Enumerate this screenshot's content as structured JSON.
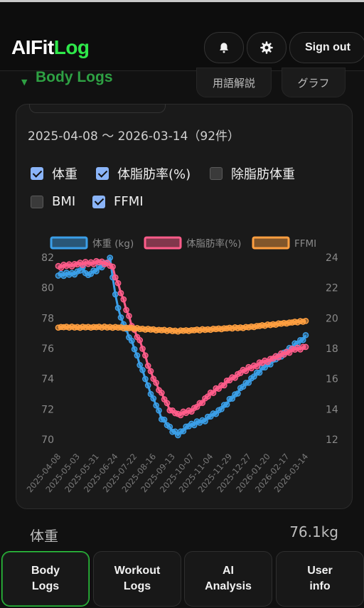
{
  "app": {
    "logo_part1": "AIFit",
    "logo_part2": "Log"
  },
  "header": {
    "bell_icon": "bell-icon",
    "settings_icon": "gear-icon",
    "sign_out_label": "Sign out"
  },
  "section": {
    "title": "Body Logs",
    "glossary_label": "用語解説",
    "graph_label": "グラフ"
  },
  "card": {
    "range_text": "2025-04-08 〜 2026-03-14（92件）",
    "checkboxes": [
      {
        "label": "体重",
        "checked": true
      },
      {
        "label": "体脂肪率(%)",
        "checked": true
      },
      {
        "label": "除脂肪体重",
        "checked": false
      },
      {
        "label": "BMI",
        "checked": false
      },
      {
        "label": "FFMI",
        "checked": true
      }
    ]
  },
  "chart_data": {
    "type": "line",
    "legend": [
      "体重 (kg)",
      "体脂肪率(%)",
      "FFMI"
    ],
    "legend_position": "top",
    "x_ticks": [
      "2025-04-08",
      "2025-05-03",
      "2025-05-31",
      "2025-06-24",
      "2025-07-22",
      "2025-08-16",
      "2025-09-13",
      "2025-10-07",
      "2025-11-04",
      "2025-11-29",
      "2025-12-27",
      "2026-01-20",
      "2026-02-17",
      "2026-03-14"
    ],
    "y_left": {
      "ticks": [
        70,
        72,
        74,
        76,
        78,
        80,
        82
      ],
      "range": [
        70,
        82
      ]
    },
    "y_right": {
      "ticks": [
        12,
        14,
        16,
        18,
        20,
        22,
        24
      ],
      "range": [
        12,
        24
      ]
    },
    "count": 92,
    "series": [
      {
        "name": "体重 (kg)",
        "axis": "left",
        "color": "#3b9fe8",
        "anchors": [
          [
            0,
            80.8
          ],
          [
            7,
            81.0
          ],
          [
            9,
            81.3
          ],
          [
            11,
            80.8
          ],
          [
            16,
            81.4
          ],
          [
            17,
            81.6
          ],
          [
            19,
            81.9
          ],
          [
            21,
            79.5
          ],
          [
            23,
            78.0
          ],
          [
            25,
            77.2
          ],
          [
            28,
            76.0
          ],
          [
            33,
            73.5
          ],
          [
            38,
            71.4
          ],
          [
            42,
            70.6
          ],
          [
            44,
            70.3
          ],
          [
            47,
            70.8
          ],
          [
            54,
            71.3
          ],
          [
            60,
            72.0
          ],
          [
            68,
            73.5
          ],
          [
            76,
            74.8
          ],
          [
            84,
            75.8
          ],
          [
            91,
            76.8
          ]
        ]
      },
      {
        "name": "体脂肪率(%)",
        "axis": "right",
        "color": "#ff5c8a",
        "anchors": [
          [
            0,
            23.4
          ],
          [
            5,
            23.5
          ],
          [
            10,
            23.6
          ],
          [
            15,
            23.7
          ],
          [
            18,
            23.6
          ],
          [
            20,
            23.3
          ],
          [
            22,
            22.2
          ],
          [
            24,
            21.2
          ],
          [
            27,
            19.5
          ],
          [
            30,
            18.5
          ],
          [
            34,
            16.4
          ],
          [
            38,
            15.0
          ],
          [
            41,
            14.0
          ],
          [
            44,
            13.6
          ],
          [
            50,
            14.0
          ],
          [
            56,
            15.0
          ],
          [
            62,
            15.8
          ],
          [
            68,
            16.5
          ],
          [
            74,
            17.0
          ],
          [
            80,
            17.4
          ],
          [
            86,
            17.9
          ],
          [
            91,
            18.1
          ]
        ]
      },
      {
        "name": "FFMI",
        "axis": "right",
        "color": "#ff9f40",
        "anchors": [
          [
            0,
            19.4
          ],
          [
            10,
            19.4
          ],
          [
            20,
            19.4
          ],
          [
            25,
            19.35
          ],
          [
            30,
            19.3
          ],
          [
            38,
            19.2
          ],
          [
            44,
            19.15
          ],
          [
            50,
            19.2
          ],
          [
            60,
            19.3
          ],
          [
            70,
            19.4
          ],
          [
            80,
            19.6
          ],
          [
            91,
            19.8
          ]
        ]
      }
    ]
  },
  "metric": {
    "name": "体重",
    "value": "76.1kg"
  },
  "nav": {
    "items": [
      "Body\nLogs",
      "Workout\nLogs",
      "AI\nAnalysis",
      "User\ninfo"
    ]
  },
  "colors": {
    "accent": "#2ee84a",
    "blue": "#3b9fe8",
    "pink": "#ff5c8a",
    "orange": "#ff9f40"
  }
}
